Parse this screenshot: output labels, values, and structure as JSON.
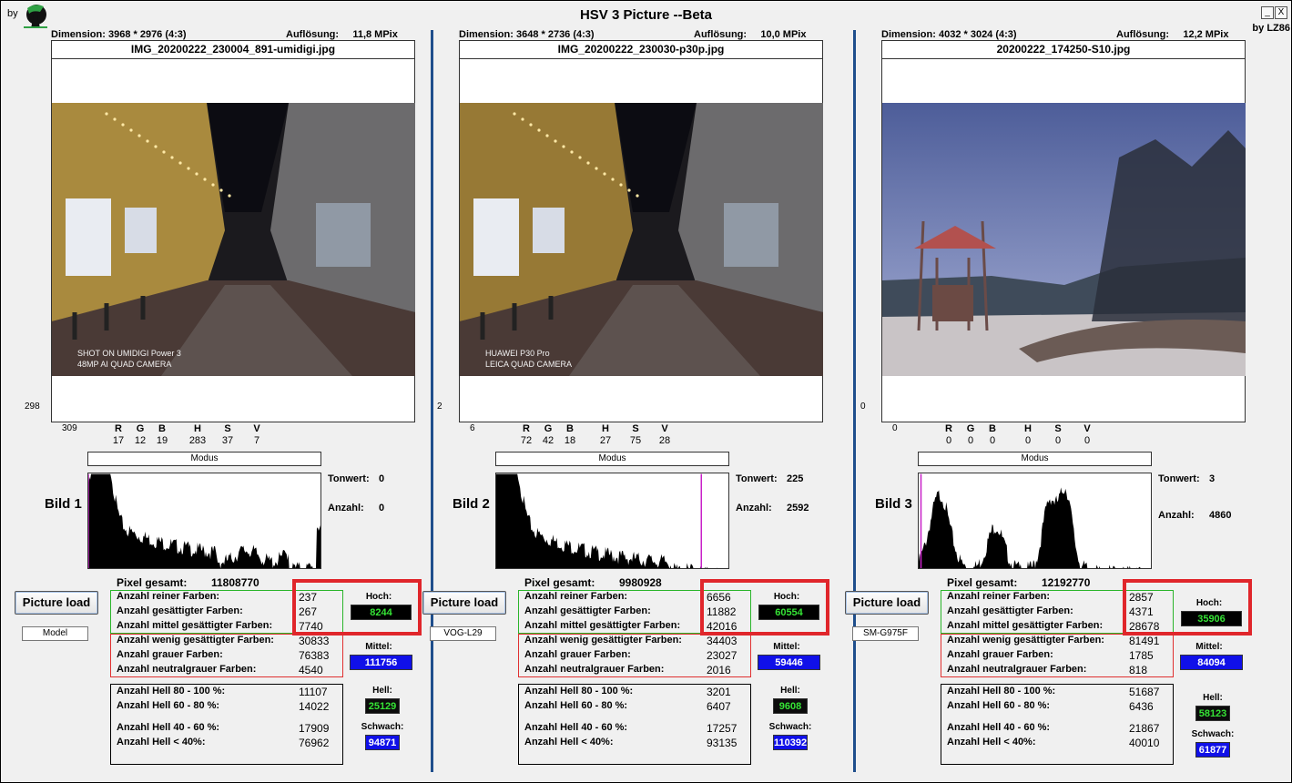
{
  "app": {
    "title": "HSV 3 Picture --Beta",
    "by": "by",
    "author": "by LZ86",
    "min_btn": "_",
    "close_btn": "X"
  },
  "labels": {
    "dimension": "Dimension:",
    "resolution": "Auflösung:",
    "modus": "Modus",
    "tonwert": "Tonwert:",
    "anzahl": "Anzahl:",
    "pixel_total": "Pixel gesamt:",
    "picture_load": "Picture load",
    "rgb": [
      "R",
      "G",
      "B",
      "H",
      "S",
      "V"
    ],
    "reiner": "Anzahl reiner Farben:",
    "gesaettigt": "Anzahl gesättigter Farben:",
    "mittel_ges": "Anzahl mittel gesättigter Farben:",
    "wenig_ges": "Anzahl wenig gesättigter Farben:",
    "grauer": "Anzahl grauer Farben:",
    "neutralgrau": "Anzahl neutralgrauer Farben:",
    "hell80": "Anzahl Hell 80 - 100 %:",
    "hell60": "Anzahl Hell 60 - 80 %:",
    "hell40": "Anzahl Hell 40 - 60 %:",
    "hell0": "Anzahl Hell < 40%:",
    "hoch": "Hoch:",
    "mittel": "Mittel:",
    "hell": "Hell:",
    "schwach": "Schwach:"
  },
  "panels": [
    {
      "dimension": "3968 * 2976 (4:3)",
      "resolution": "11,8 MPix",
      "filename": "IMG_20200222_230004_891-umidigi.jpg",
      "left_value": "298",
      "corner_value": "309",
      "rgb_values": [
        "17",
        "12",
        "19",
        "283",
        "37",
        "7"
      ],
      "bild": "Bild 1",
      "tonwert": "0",
      "anzahl": "0",
      "pixel_total": "11808770",
      "model": "Model",
      "reiner": "237",
      "gesaettigt": "267",
      "mittel_ges": "7740",
      "wenig_ges": "30833",
      "grauer": "76383",
      "neutralgrau": "4540",
      "hoch": "8244",
      "mittel": "111756",
      "hell80": "11107",
      "hell60": "14022",
      "hell40": "17909",
      "hell0": "76962",
      "hell": "25129",
      "schwach": "94871",
      "watermark": [
        "SHOT ON UMIDIGI Power 3",
        "48MP AI QUAD CAMERA"
      ],
      "marker_pos": 0.0
    },
    {
      "dimension": "3648 * 2736 (4:3)",
      "resolution": "10,0 MPix",
      "filename": "IMG_20200222_230030-p30p.jpg",
      "left_value": "2",
      "corner_value": "6",
      "rgb_values": [
        "72",
        "42",
        "18",
        "27",
        "75",
        "28"
      ],
      "bild": "Bild 2",
      "tonwert": "225",
      "anzahl": "2592",
      "pixel_total": "9980928",
      "model": "VOG-L29",
      "reiner": "6656",
      "gesaettigt": "11882",
      "mittel_ges": "42016",
      "wenig_ges": "34403",
      "grauer": "23027",
      "neutralgrau": "2016",
      "hoch": "60554",
      "mittel": "59446",
      "hell80": "3201",
      "hell60": "6407",
      "hell40": "17257",
      "hell0": "93135",
      "hell": "9608",
      "schwach": "110392",
      "watermark": [
        "HUAWEI P30 Pro",
        "LEICA QUAD CAMERA"
      ],
      "marker_pos": 0.88
    },
    {
      "dimension": "4032 * 3024 (4:3)",
      "resolution": "12,2 MPix",
      "filename": "20200222_174250-S10.jpg",
      "left_value": "0",
      "corner_value": "0",
      "rgb_values": [
        "0",
        "0",
        "0",
        "0",
        "0",
        "0"
      ],
      "bild": "Bild 3",
      "tonwert": "3",
      "anzahl": "4860",
      "pixel_total": "12192770",
      "model": "SM-G975F",
      "reiner": "2857",
      "gesaettigt": "4371",
      "mittel_ges": "28678",
      "wenig_ges": "81491",
      "grauer": "1785",
      "neutralgrau": "818",
      "hoch": "35906",
      "mittel": "84094",
      "hell80": "51687",
      "hell60": "6436",
      "hell40": "21867",
      "hell0": "40010",
      "hell": "58123",
      "schwach": "61877",
      "watermark": [],
      "marker_pos": 0.01
    }
  ],
  "colors": {
    "divider": "#1f4e8c",
    "hoch_bg": "#000000",
    "hoch_fg": "#35e335",
    "blue_pill": "#1010e8",
    "highlight": "#e0262b"
  }
}
